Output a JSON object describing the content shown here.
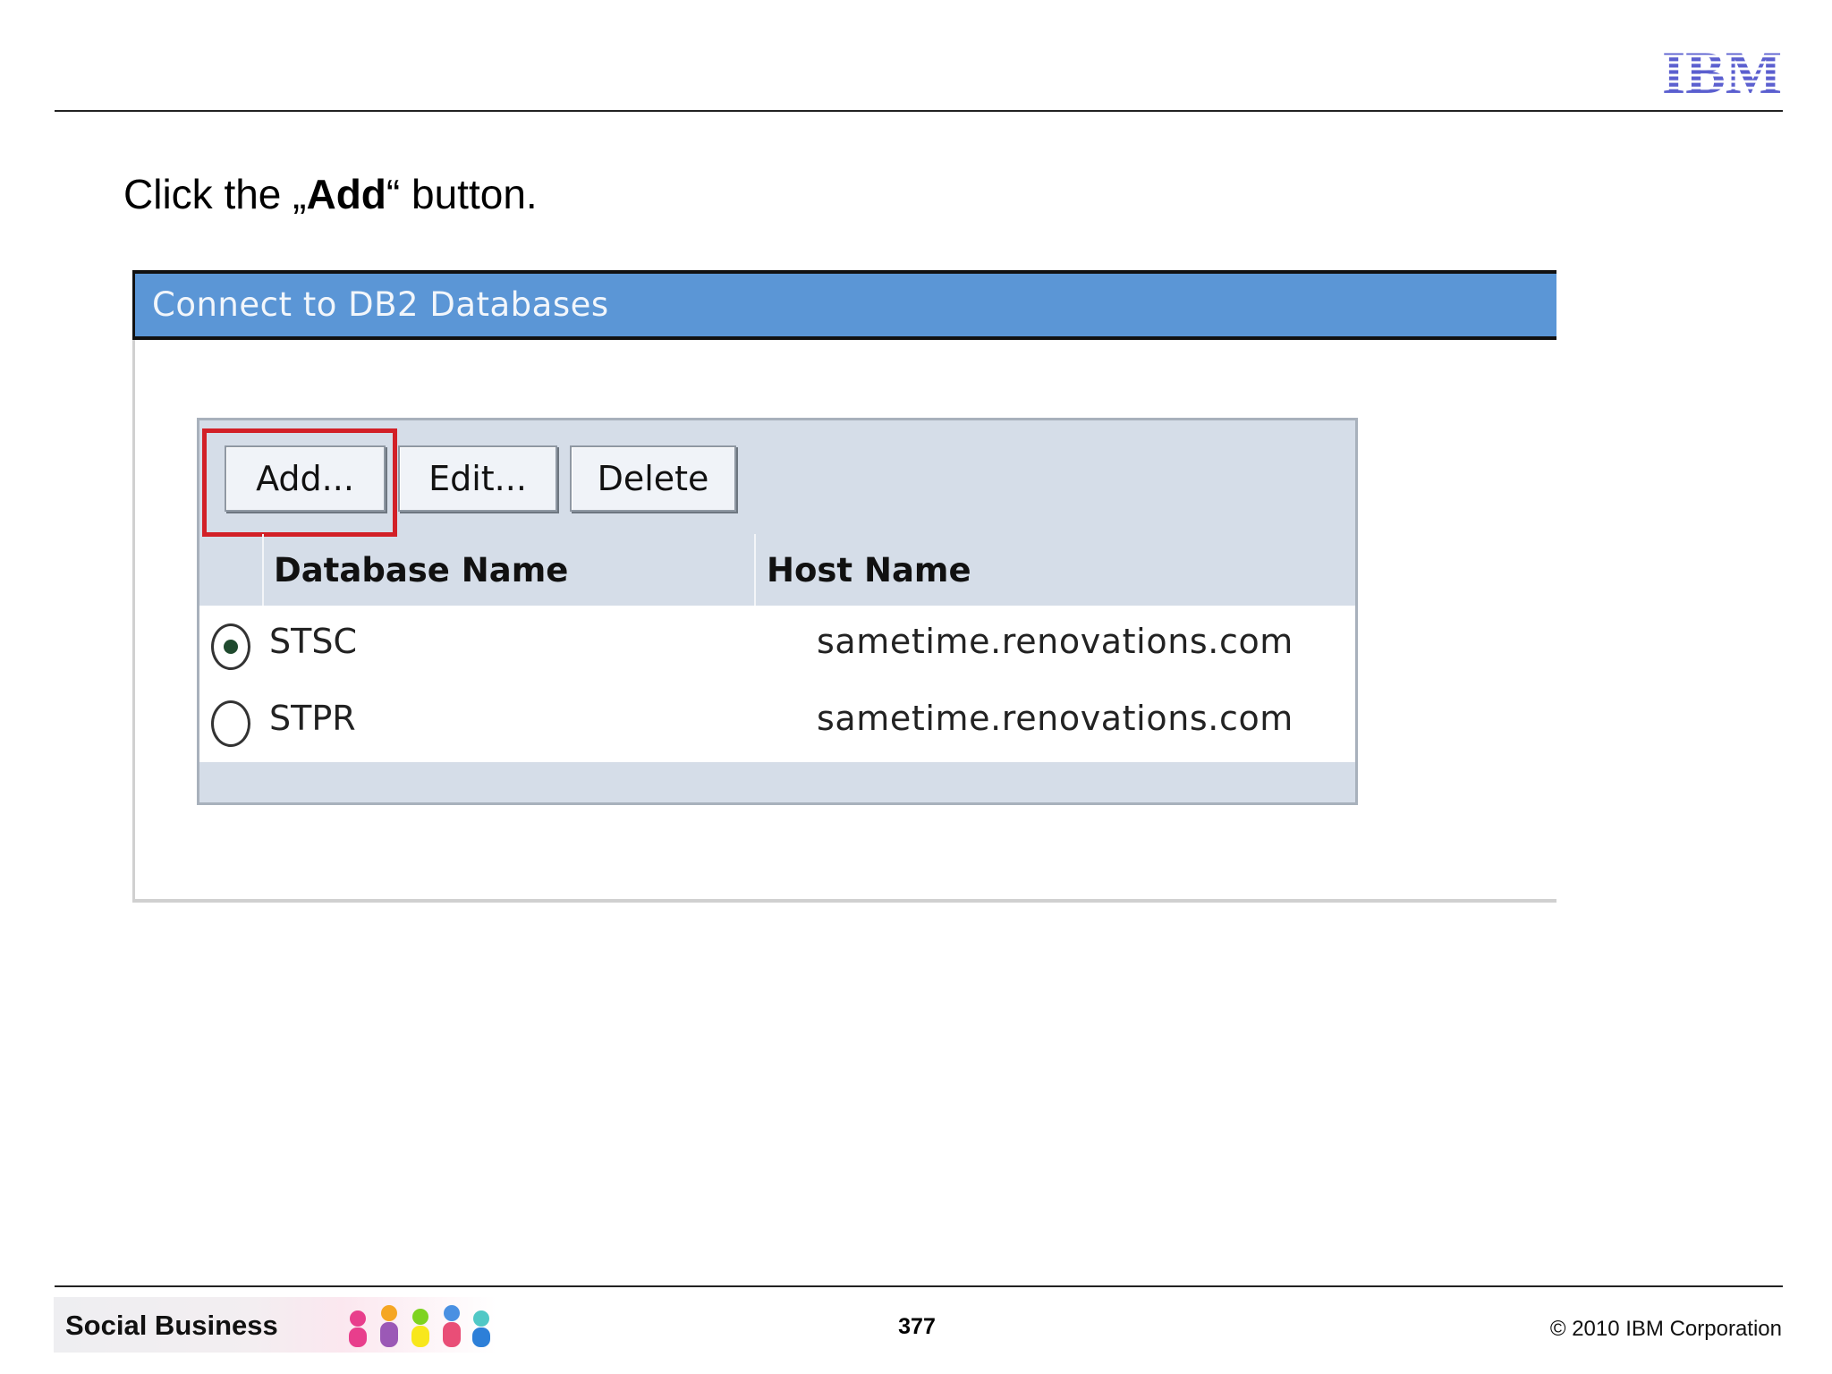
{
  "brand": {
    "logo_text": "IBM",
    "logo_color": "#5b5fcf"
  },
  "slide": {
    "instruction_prefix": "Click the „",
    "instruction_bold": "Add",
    "instruction_suffix": "“ button."
  },
  "panel": {
    "title": "Connect to DB2 Databases",
    "toolbar": {
      "add_label": "Add...",
      "edit_label": "Edit...",
      "delete_label": "Delete"
    },
    "highlight_color": "#d22027",
    "columns": [
      "Database Name",
      "Host Name"
    ],
    "rows": [
      {
        "selected": true,
        "database": "STSC",
        "host": "sametime.renovations.com"
      },
      {
        "selected": false,
        "database": "STPR",
        "host": "sametime.renovations.com"
      }
    ],
    "title_bar_color": "#5b96d6"
  },
  "footer": {
    "banner_label": "Social Business",
    "page_number": "377",
    "copyright": "© 2010 IBM Corporation"
  }
}
